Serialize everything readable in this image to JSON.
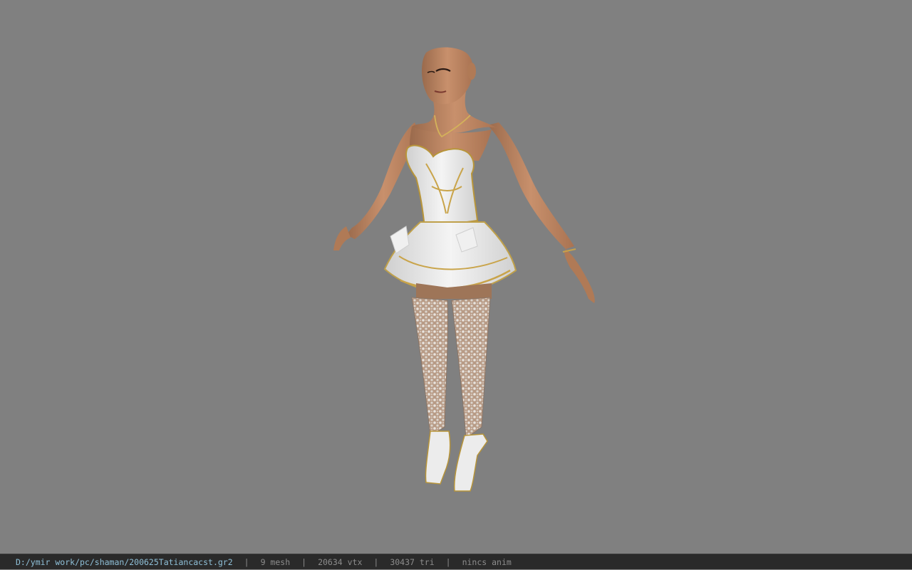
{
  "viewer": {
    "background_color": "#808080",
    "model": {
      "description_icon": "character-model-icon"
    }
  },
  "status_bar": {
    "file_path": "D:/ymir work/pc/shaman/200625Tatiancacst.gr2",
    "separator": "|",
    "mesh_count": "9 mesh",
    "vertex_count": "20634 vtx",
    "triangle_count": "30437 tri",
    "anim_status": "nincs anim"
  }
}
